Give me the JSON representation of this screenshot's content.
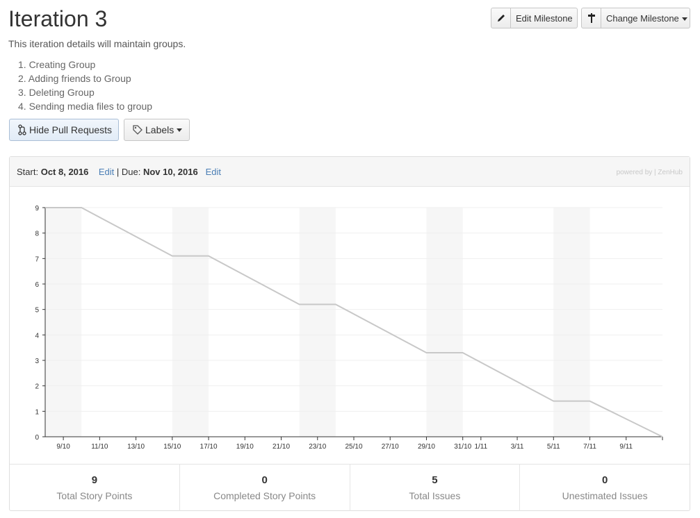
{
  "header": {
    "title": "Iteration 3",
    "description": "This iteration details will maintain groups.",
    "steps": [
      "1. Creating Group",
      "2. Adding friends to Group",
      "3. Deleting Group",
      "4. Sending media files to group"
    ]
  },
  "toolbar": {
    "edit_milestone": "Edit Milestone",
    "change_milestone": "Change Milestone",
    "hide_pull_requests": "Hide Pull Requests",
    "labels": "Labels"
  },
  "milestone": {
    "start_label": "Start:",
    "start_date": "Oct 8, 2016",
    "edit_start": "Edit",
    "separator": "|",
    "due_label": "Due:",
    "due_date": "Nov 10, 2016",
    "edit_due": "Edit",
    "powered_by": "powered by",
    "brand": "ZenHub"
  },
  "chart_data": {
    "type": "line",
    "ylim": [
      0,
      9
    ],
    "y_ticks": [
      0,
      1,
      2,
      3,
      4,
      5,
      6,
      7,
      8,
      9
    ],
    "x_tick_labels": [
      "9/10",
      "11/10",
      "13/10",
      "15/10",
      "17/10",
      "19/10",
      "21/10",
      "23/10",
      "25/10",
      "27/10",
      "29/10",
      "31/10",
      "1/11",
      "3/11",
      "5/11",
      "7/11",
      "9/11"
    ],
    "x_tick_days": [
      1,
      3,
      5,
      7,
      9,
      11,
      13,
      15,
      17,
      19,
      21,
      23,
      24,
      26,
      28,
      30,
      32
    ],
    "x_range_days": [
      0,
      34
    ],
    "weekend_bands": [
      [
        0,
        2
      ],
      [
        7,
        9
      ],
      [
        14,
        16
      ],
      [
        21,
        23
      ],
      [
        28,
        30
      ]
    ],
    "series": [
      {
        "x": [
          0,
          2,
          7,
          9,
          14,
          16,
          21,
          23,
          28,
          30,
          34
        ],
        "y": [
          9,
          9,
          7.1,
          7.1,
          5.2,
          5.2,
          3.3,
          3.3,
          1.4,
          1.4,
          0
        ]
      }
    ],
    "line_color": "#c8c8c8",
    "band_color": "#f6f6f6",
    "grid": true
  },
  "stats": [
    {
      "value": "9",
      "label": "Total Story Points"
    },
    {
      "value": "0",
      "label": "Completed Story Points"
    },
    {
      "value": "5",
      "label": "Total Issues"
    },
    {
      "value": "0",
      "label": "Unestimated Issues"
    }
  ]
}
